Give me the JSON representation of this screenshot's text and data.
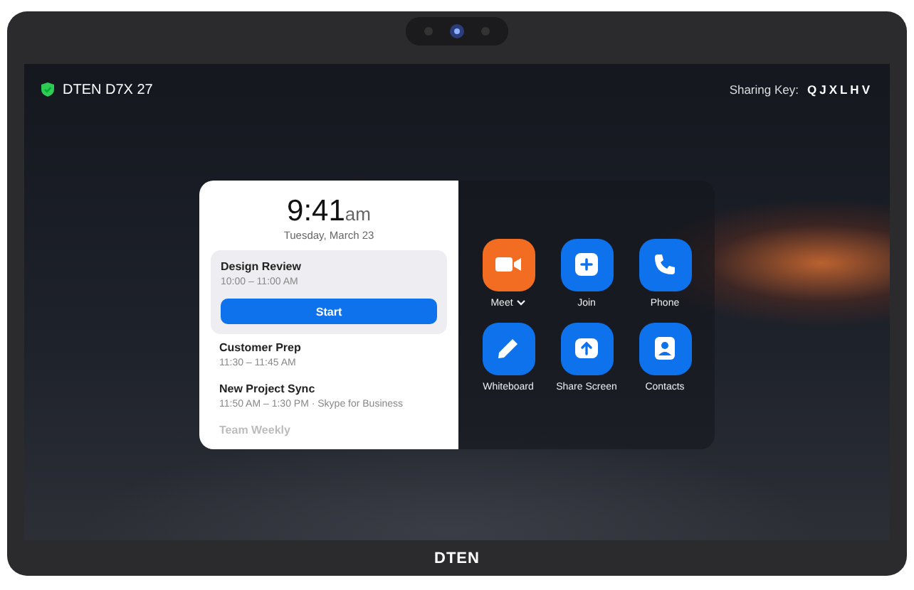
{
  "device": {
    "brand": "DTEN"
  },
  "header": {
    "device_name": "DTEN D7X 27",
    "sharing_key_label": "Sharing Key:",
    "sharing_key": "QJXLHV"
  },
  "clock": {
    "time": "9:41",
    "period": "am",
    "date": "Tuesday, March 23"
  },
  "events": [
    {
      "title": "Design Review",
      "time": "10:00 – 11:00 AM",
      "selected": true,
      "action": "Start",
      "faded": false
    },
    {
      "title": "Customer Prep",
      "time": "11:30 – 11:45 AM",
      "selected": false,
      "faded": false
    },
    {
      "title": "New Project Sync",
      "time": "11:50 AM – 1:30 PM · Skype for Business",
      "selected": false,
      "faded": false
    },
    {
      "title": "Team Weekly",
      "selected": false,
      "faded": true
    }
  ],
  "apps": [
    {
      "label": "Meet",
      "kind": "meet",
      "color": "#f26d21",
      "dropdown": true
    },
    {
      "label": "Join",
      "kind": "join",
      "color": "#0e72ed",
      "dropdown": false
    },
    {
      "label": "Phone",
      "kind": "phone",
      "color": "#0e72ed",
      "dropdown": false
    },
    {
      "label": "Whiteboard",
      "kind": "whiteboard",
      "color": "#0e72ed",
      "dropdown": false
    },
    {
      "label": "Share Screen",
      "kind": "share",
      "color": "#0e72ed",
      "dropdown": false
    },
    {
      "label": "Contacts",
      "kind": "contacts",
      "color": "#0e72ed",
      "dropdown": false
    }
  ]
}
